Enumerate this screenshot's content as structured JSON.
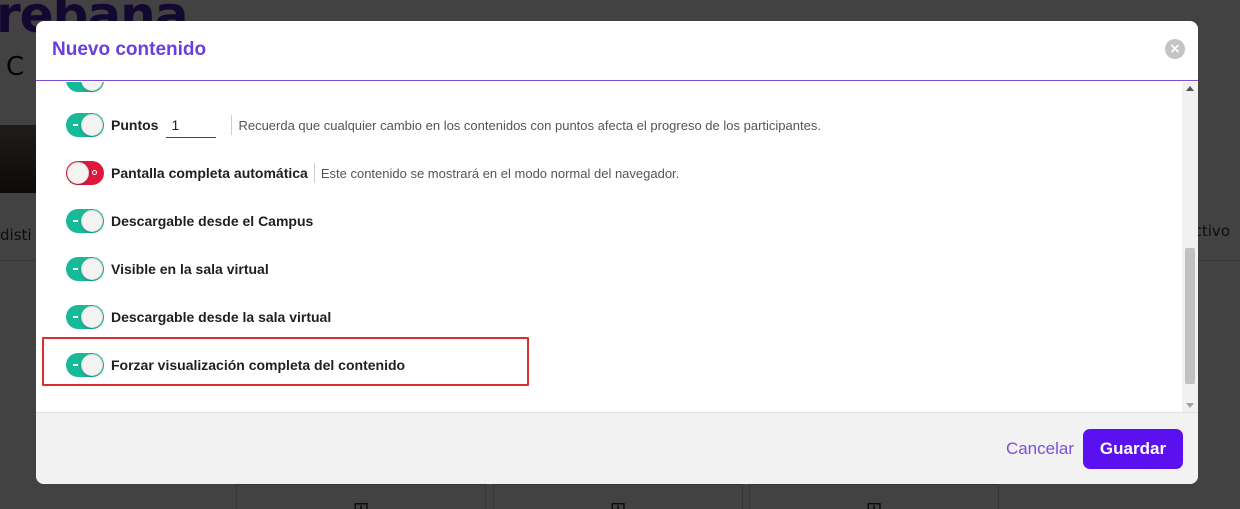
{
  "background": {
    "logo_text": "rebana",
    "subtitle_text": "C A",
    "tab_left": "disti",
    "tab_right": "ctivo",
    "cards_plus": [
      "⊞",
      "⊞",
      "⊞"
    ]
  },
  "modal": {
    "title": "Nuevo contenido",
    "close_icon": "×",
    "rows": [
      {
        "id": "puntos",
        "label": "Puntos",
        "enabled": true,
        "input_value": "1",
        "hint": "Recuerda que cualquier cambio en los contenidos con puntos afecta el progreso de los participantes."
      },
      {
        "id": "pantalla",
        "label": "Pantalla completa automática",
        "enabled": false,
        "hint": "Este contenido se mostrará en el modo normal del navegador."
      },
      {
        "id": "descargable-campus",
        "label": "Descargable desde el Campus",
        "enabled": true
      },
      {
        "id": "visible-sala",
        "label": "Visible en la sala virtual",
        "enabled": true
      },
      {
        "id": "descargable-sala",
        "label": "Descargable desde la sala virtual",
        "enabled": true
      },
      {
        "id": "forzar",
        "label": "Forzar visualización completa del contenido",
        "enabled": true
      }
    ],
    "footer": {
      "cancel_label": "Cancelar",
      "save_label": "Guardar"
    }
  },
  "colors": {
    "accent": "#5a10ef",
    "title": "#6a3fe0",
    "toggle_on": "#16b998",
    "toggle_off": "#e0173d",
    "highlight": "#d9302f"
  }
}
